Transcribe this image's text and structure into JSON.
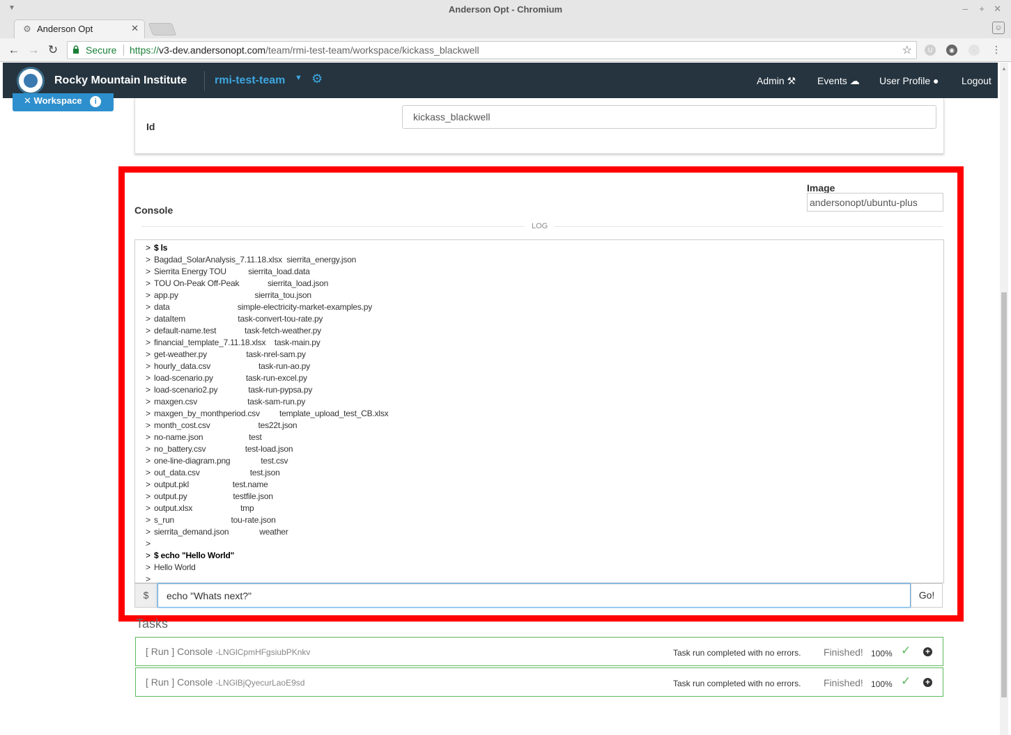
{
  "browser": {
    "window_title": "Anderson Opt - Chromium",
    "tab_title": "Anderson Opt",
    "secure_label": "Secure",
    "url_scheme": "https://",
    "url_host": "v3-dev.andersonopt.com",
    "url_path": "/team/rmi-test-team/workspace/kickass_blackwell"
  },
  "navbar": {
    "brand": "Rocky Mountain Institute",
    "team": "rmi-test-team",
    "links": {
      "admin": "Admin",
      "events": "Events",
      "profile": "User Profile",
      "logout": "Logout"
    }
  },
  "workspace_button": {
    "label": "Workspace"
  },
  "id_field": {
    "label": "Id",
    "value": "kickass_blackwell"
  },
  "console": {
    "title": "Console",
    "image_label": "Image",
    "image_value": "andersonopt/ubuntu-plus",
    "log_label": "LOG",
    "log_lines": [
      {
        "text": "$ ls",
        "cmd": true
      },
      {
        "text": "Bagdad_SolarAnalysis_7.11.18.xlsx  sierrita_energy.json"
      },
      {
        "text": "Sierrita Energy TOU          sierrita_load.data"
      },
      {
        "text": "TOU On-Peak Off-Peak             sierrita_load.json"
      },
      {
        "text": "app.py                                   sierrita_tou.json"
      },
      {
        "text": "data                               simple-electricity-market-examples.py"
      },
      {
        "text": "dataItem                        task-convert-tou-rate.py"
      },
      {
        "text": "default-name.test             task-fetch-weather.py"
      },
      {
        "text": "financial_template_7.11.18.xlsx    task-main.py"
      },
      {
        "text": "get-weather.py                  task-nrel-sam.py"
      },
      {
        "text": "hourly_data.csv                      task-run-ao.py"
      },
      {
        "text": "load-scenario.py               task-run-excel.py"
      },
      {
        "text": "load-scenario2.py              task-run-pypsa.py"
      },
      {
        "text": "maxgen.csv                       task-sam-run.py"
      },
      {
        "text": "maxgen_by_monthperiod.csv         template_upload_test_CB.xlsx"
      },
      {
        "text": "month_cost.csv                      tes22t.json"
      },
      {
        "text": "no-name.json                     test"
      },
      {
        "text": "no_battery.csv                  test-load.json"
      },
      {
        "text": "one-line-diagram.png              test.csv"
      },
      {
        "text": "out_data.csv                       test.json"
      },
      {
        "text": "output.pkl                    test.name"
      },
      {
        "text": "output.py                     testfile.json"
      },
      {
        "text": "output.xlsx                      tmp"
      },
      {
        "text": "s_run                          tou-rate.json"
      },
      {
        "text": "sierrita_demand.json              weather"
      },
      {
        "text": ""
      },
      {
        "text": "$ echo \"Hello World\"",
        "cmd": true
      },
      {
        "text": "Hello World"
      },
      {
        "text": ""
      }
    ],
    "prompt_symbol": "$",
    "input_value": "echo \"Whats next?\"",
    "go_label": "Go!"
  },
  "tasks": {
    "heading": "Tasks",
    "items": [
      {
        "name": "[ Run ] Console",
        "id": "-LNGlCpmHFgsiubPKnkv",
        "message": "Task run completed with no errors.",
        "status": "Finished!",
        "progress": "100%"
      },
      {
        "name": "[ Run ] Console",
        "id": "-LNGlBjQyecurLaoE9sd",
        "message": "Task run completed with no errors.",
        "status": "Finished!",
        "progress": "100%"
      }
    ]
  },
  "colors": {
    "navbar": "#25343f",
    "accent": "#3ea6e0",
    "highlight": "#ff0000",
    "success": "#5cb85c"
  }
}
